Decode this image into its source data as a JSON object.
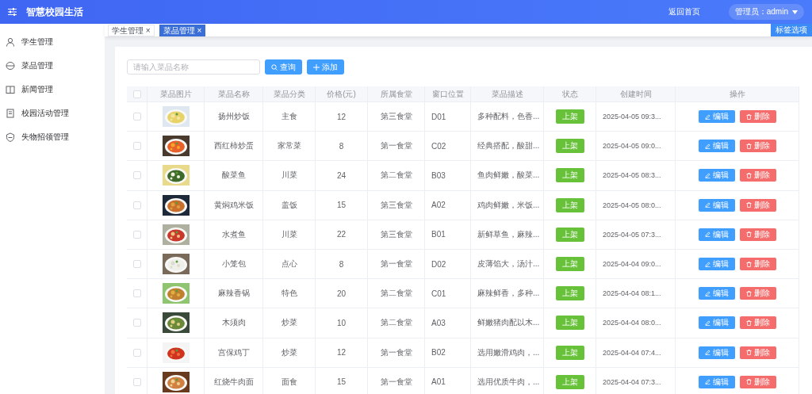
{
  "header": {
    "title": "智慧校园生活",
    "home_link": "返回首页",
    "user_menu": "管理员：admin"
  },
  "sidebar": {
    "items": [
      {
        "label": "学生管理",
        "selected": false
      },
      {
        "label": "菜品管理",
        "selected": false
      },
      {
        "label": "新闻管理",
        "selected": false
      },
      {
        "label": "校园活动管理",
        "selected": false
      },
      {
        "label": "失物招领管理",
        "selected": false
      }
    ]
  },
  "tabs": [
    {
      "label": "学生管理",
      "close": "×",
      "selected": false
    },
    {
      "label": "菜品管理",
      "close": "×",
      "selected": true
    }
  ],
  "tab_options_button": "标签选项",
  "toolbar": {
    "search": {
      "placeholder": "请输入菜品名称"
    },
    "search_button": "查询",
    "add_button": "添加"
  },
  "table": {
    "select_all_checked": false,
    "columns": [
      "菜品图片",
      "菜品名称",
      "菜品分类",
      "价格(元)",
      "所属食堂",
      "窗口位置",
      "菜品描述",
      "状态",
      "创建时间",
      "操作"
    ],
    "rows": [
      {
        "checked": false,
        "name": "扬州炒饭",
        "category": "主食",
        "price": "12",
        "canteen": "第三食堂",
        "window": "D01",
        "description": "多种配料，色香...",
        "status": "上架",
        "created": "2025-04-05 09:3...",
        "edit": "编辑",
        "delete": "删除"
      },
      {
        "checked": false,
        "name": "西红柿炒蛋",
        "category": "家常菜",
        "price": "8",
        "canteen": "第一食堂",
        "window": "C02",
        "description": "经典搭配，酸甜...",
        "status": "上架",
        "created": "2025-04-05 09:0...",
        "edit": "编辑",
        "delete": "删除"
      },
      {
        "checked": false,
        "name": "酸菜鱼",
        "category": "川菜",
        "price": "24",
        "canteen": "第二食堂",
        "window": "B03",
        "description": "鱼肉鲜嫩，酸菜...",
        "status": "上架",
        "created": "2025-04-05 08:3...",
        "edit": "编辑",
        "delete": "删除"
      },
      {
        "checked": false,
        "name": "黄焖鸡米饭",
        "category": "盖饭",
        "price": "15",
        "canteen": "第三食堂",
        "window": "A02",
        "description": "鸡肉鲜嫩，米饭...",
        "status": "上架",
        "created": "2025-04-05 08:0...",
        "edit": "编辑",
        "delete": "删除"
      },
      {
        "checked": false,
        "name": "水煮鱼",
        "category": "川菜",
        "price": "22",
        "canteen": "第三食堂",
        "window": "B01",
        "description": "新鲜草鱼，麻辣...",
        "status": "上架",
        "created": "2025-04-05 07:3...",
        "edit": "编辑",
        "delete": "删除"
      },
      {
        "checked": false,
        "name": "小笼包",
        "category": "点心",
        "price": "8",
        "canteen": "第一食堂",
        "window": "D02",
        "description": "皮薄馅大，汤汁...",
        "status": "上架",
        "created": "2025-04-04 09:0...",
        "edit": "编辑",
        "delete": "删除"
      },
      {
        "checked": false,
        "name": "麻辣香锅",
        "category": "特色",
        "price": "20",
        "canteen": "第二食堂",
        "window": "C01",
        "description": "麻辣鲜香，多种...",
        "status": "上架",
        "created": "2025-04-04 08:1...",
        "edit": "编辑",
        "delete": "删除"
      },
      {
        "checked": false,
        "name": "木须肉",
        "category": "炒菜",
        "price": "10",
        "canteen": "第二食堂",
        "window": "A03",
        "description": "鲜嫩猪肉配以木...",
        "status": "上架",
        "created": "2025-04-04 08:0...",
        "edit": "编辑",
        "delete": "删除"
      },
      {
        "checked": false,
        "name": "宫保鸡丁",
        "category": "炒菜",
        "price": "12",
        "canteen": "第一食堂",
        "window": "B02",
        "description": "选用嫩滑鸡肉，...",
        "status": "上架",
        "created": "2025-04-04 07:4...",
        "edit": "编辑",
        "delete": "删除"
      },
      {
        "checked": false,
        "name": "红烧牛肉面",
        "category": "面食",
        "price": "15",
        "canteen": "第一食堂",
        "window": "A01",
        "description": "选用优质牛肉，...",
        "status": "上架",
        "created": "2025-04-04 07:3...",
        "edit": "编辑",
        "delete": "删除"
      }
    ]
  }
}
